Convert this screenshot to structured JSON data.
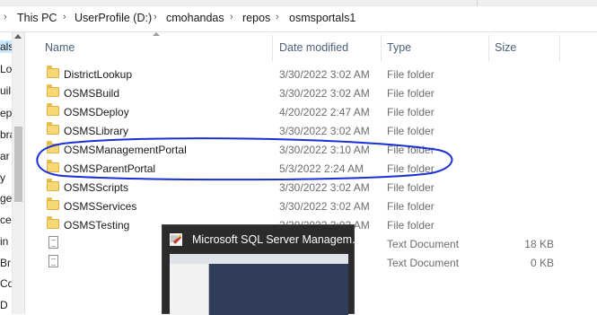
{
  "breadcrumb": {
    "items": [
      "This PC",
      "UserProfile (D:)",
      "cmohandas",
      "repos",
      "osmsportals1"
    ]
  },
  "nav_pane": {
    "items": [
      "als",
      "Loc",
      "uil",
      "ep",
      "bra",
      "ar",
      "y",
      "ges",
      "ce",
      "in",
      "Br",
      "Co",
      "D"
    ]
  },
  "columns": {
    "name": "Name",
    "date": "Date modified",
    "type": "Type",
    "size": "Size"
  },
  "files": [
    {
      "name": "DistrictLookup",
      "date": "3/30/2022 3:02 AM",
      "type": "File folder",
      "size": "",
      "icon": "folder-icon"
    },
    {
      "name": "OSMSBuild",
      "date": "3/30/2022 3:02 AM",
      "type": "File folder",
      "size": "",
      "icon": "folder-icon"
    },
    {
      "name": "OSMSDeploy",
      "date": "4/20/2022 2:47 AM",
      "type": "File folder",
      "size": "",
      "icon": "folder-icon"
    },
    {
      "name": "OSMSLibrary",
      "date": "3/30/2022 3:02 AM",
      "type": "File folder",
      "size": "",
      "icon": "folder-icon"
    },
    {
      "name": "OSMSManagementPortal",
      "date": "3/30/2022 3:10 AM",
      "type": "File folder",
      "size": "",
      "icon": "folder-icon"
    },
    {
      "name": "OSMSParentPortal",
      "date": "5/3/2022 2:24 AM",
      "type": "File folder",
      "size": "",
      "icon": "folder-icon"
    },
    {
      "name": "OSMSScripts",
      "date": "3/30/2022 3:02 AM",
      "type": "File folder",
      "size": "",
      "icon": "folder-icon"
    },
    {
      "name": "OSMSServices",
      "date": "3/30/2022 3:02 AM",
      "type": "File folder",
      "size": "",
      "icon": "folder-icon"
    },
    {
      "name": "OSMSTesting",
      "date": "3/30/2022 3:02 AM",
      "type": "File folder",
      "size": "",
      "icon": "folder-icon"
    },
    {
      "name": "",
      "date": "",
      "type": "Text Document",
      "size": "18 KB",
      "icon": "text-document-icon"
    },
    {
      "name": "",
      "date": "",
      "type": "Text Document",
      "size": "0 KB",
      "icon": "text-document-icon"
    }
  ],
  "taskbar_preview": {
    "title": "Microsoft SQL Server Managem...",
    "icon": "ssms-app-icon"
  },
  "annotation": {
    "color": "#1a2fd6",
    "icon": "hand-drawn-ellipse"
  }
}
